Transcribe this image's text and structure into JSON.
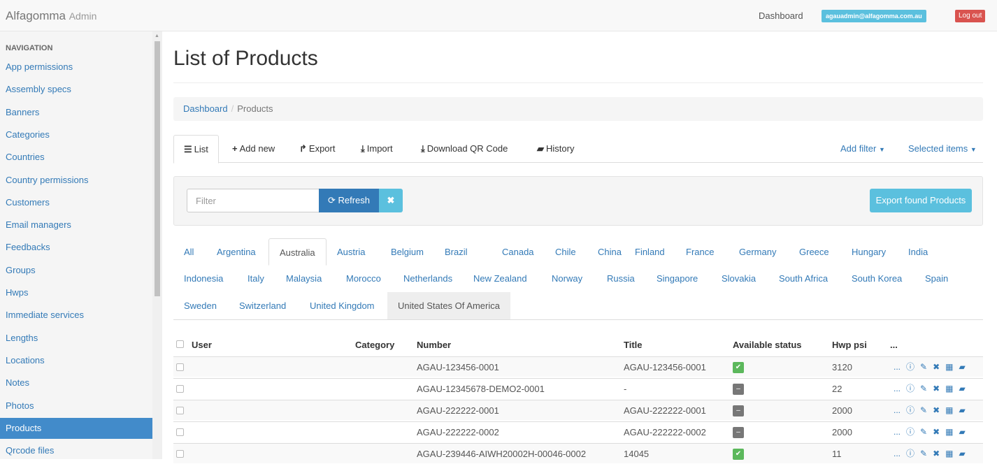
{
  "app": {
    "brand": "Alfagomma",
    "brand_sub": "Admin"
  },
  "topnav": {
    "dashboard": "Dashboard",
    "user_email": "agauadmin@alfagomma.com.au",
    "logout": "Log out"
  },
  "sidebar": {
    "heading": "NAVIGATION",
    "items": [
      {
        "label": "App permissions"
      },
      {
        "label": "Assembly specs"
      },
      {
        "label": "Banners"
      },
      {
        "label": "Categories"
      },
      {
        "label": "Countries"
      },
      {
        "label": "Country permissions"
      },
      {
        "label": "Customers"
      },
      {
        "label": "Email managers"
      },
      {
        "label": "Feedbacks"
      },
      {
        "label": "Groups"
      },
      {
        "label": "Hwps"
      },
      {
        "label": "Immediate services"
      },
      {
        "label": "Lengths"
      },
      {
        "label": "Locations"
      },
      {
        "label": "Notes"
      },
      {
        "label": "Photos"
      },
      {
        "label": "Products",
        "active": true
      },
      {
        "label": "Qrcode files"
      }
    ]
  },
  "page": {
    "title": "List of Products"
  },
  "breadcrumb": {
    "home": "Dashboard",
    "sep": "/",
    "current": "Products"
  },
  "tabs": {
    "list": "List",
    "add_new": "Add new",
    "export": "Export",
    "import": "Import",
    "download_qr": "Download QR Code",
    "history": "History",
    "add_filter": "Add filter",
    "selected_items": "Selected items"
  },
  "filter": {
    "placeholder": "Filter",
    "refresh": "Refresh",
    "clear": "✖",
    "export_found": "Export found Products"
  },
  "countries": {
    "row1": [
      "All",
      "Argentina",
      "Australia",
      "Austria",
      "Belgium",
      "Brazil",
      "Canada",
      "Chile",
      "China",
      "Finland",
      "France",
      "Germany",
      "Greece",
      "Hungary",
      "India"
    ],
    "row2": [
      "Indonesia",
      "Italy",
      "Malaysia",
      "Morocco",
      "Netherlands",
      "New Zealand",
      "Norway",
      "Russia",
      "Singapore",
      "Slovakia",
      "South Africa",
      "South Korea",
      "Spain"
    ],
    "row3": [
      "Sweden",
      "Switzerland",
      "United Kingdom",
      "United States Of America"
    ],
    "active": "Australia"
  },
  "table": {
    "headers": {
      "user": "User",
      "category": "Category",
      "number": "Number",
      "title": "Title",
      "status": "Available status",
      "hwp": "Hwp psi",
      "more": "..."
    },
    "rows": [
      {
        "user": "",
        "category": "",
        "number": "AGAU-123456-0001",
        "title": "AGAU-123456-0001",
        "available": true,
        "hwp": "3120"
      },
      {
        "user": "",
        "category": "",
        "number": "AGAU-12345678-DEMO2-0001",
        "title": "-",
        "available": false,
        "hwp": "22"
      },
      {
        "user": "",
        "category": "",
        "number": "AGAU-222222-0001",
        "title": "AGAU-222222-0001",
        "available": false,
        "hwp": "2000"
      },
      {
        "user": "",
        "category": "",
        "number": "AGAU-222222-0002",
        "title": "AGAU-222222-0002",
        "available": false,
        "hwp": "2000"
      },
      {
        "user": "",
        "category": "",
        "number": "AGAU-239446-AIWH20002H-00046-0002",
        "title": "14045",
        "available": true,
        "hwp": "11"
      }
    ],
    "row_actions": {
      "more": "...",
      "show_icon": "info-icon",
      "edit_icon": "pencil-icon",
      "delete_icon": "close-icon",
      "qr_icon": "qrcode-icon",
      "history_icon": "book-icon"
    }
  },
  "colors": {
    "primary": "#337ab7",
    "info": "#5bc0de",
    "danger": "#d9534f",
    "success": "#5cb85c",
    "active_nav": "#428bca"
  }
}
